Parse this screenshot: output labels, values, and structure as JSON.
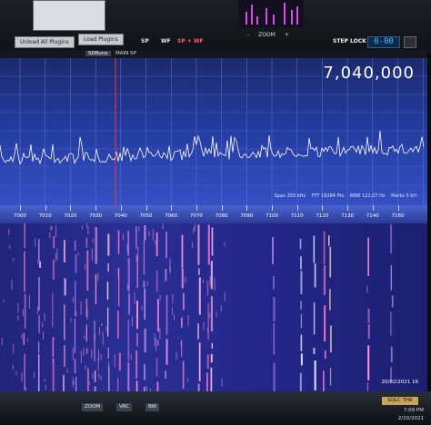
{
  "toolbar": {
    "unload_label": "Unload All Plugins",
    "load_label": "Load Plugins",
    "sp_label": "SP",
    "wf_label": "WF",
    "spwf_label": "SP + WF",
    "zoom_label": "ZOOM",
    "zoom_minus": "-",
    "zoom_plus": "+",
    "step_lock_label": "STEP LOCK",
    "step_value": "0-00"
  },
  "panel": {
    "tab_sdr": "SDRuno",
    "tab_main": "MAIN SP"
  },
  "spectrum": {
    "frequency": "7,040,000",
    "span": "Span 250 kHz",
    "fft": "FFT 16384 Pts",
    "rbw": "RBW 122.07 Hz",
    "marks": "Marks 5 kH",
    "freq_ticks": [
      "7000",
      "7010",
      "7020",
      "7030",
      "7040",
      "7050",
      "7060",
      "7070",
      "7080",
      "7090",
      "7100",
      "7110",
      "7120",
      "7130",
      "7140",
      "7160"
    ]
  },
  "waterfall": {
    "timestamp": "20/02/2021 16"
  },
  "bottom": {
    "zoom": "ZOOM",
    "vrc": "VRC",
    "bw": "BW",
    "sqlc": "SQLC THR",
    "time": "7:09 PM",
    "date": "2/20/2021"
  },
  "colors": {
    "spectrum_trace": "#ffffff",
    "tuning_marker": "#ff3333",
    "waterfall_signal": "#ff7ad9"
  }
}
